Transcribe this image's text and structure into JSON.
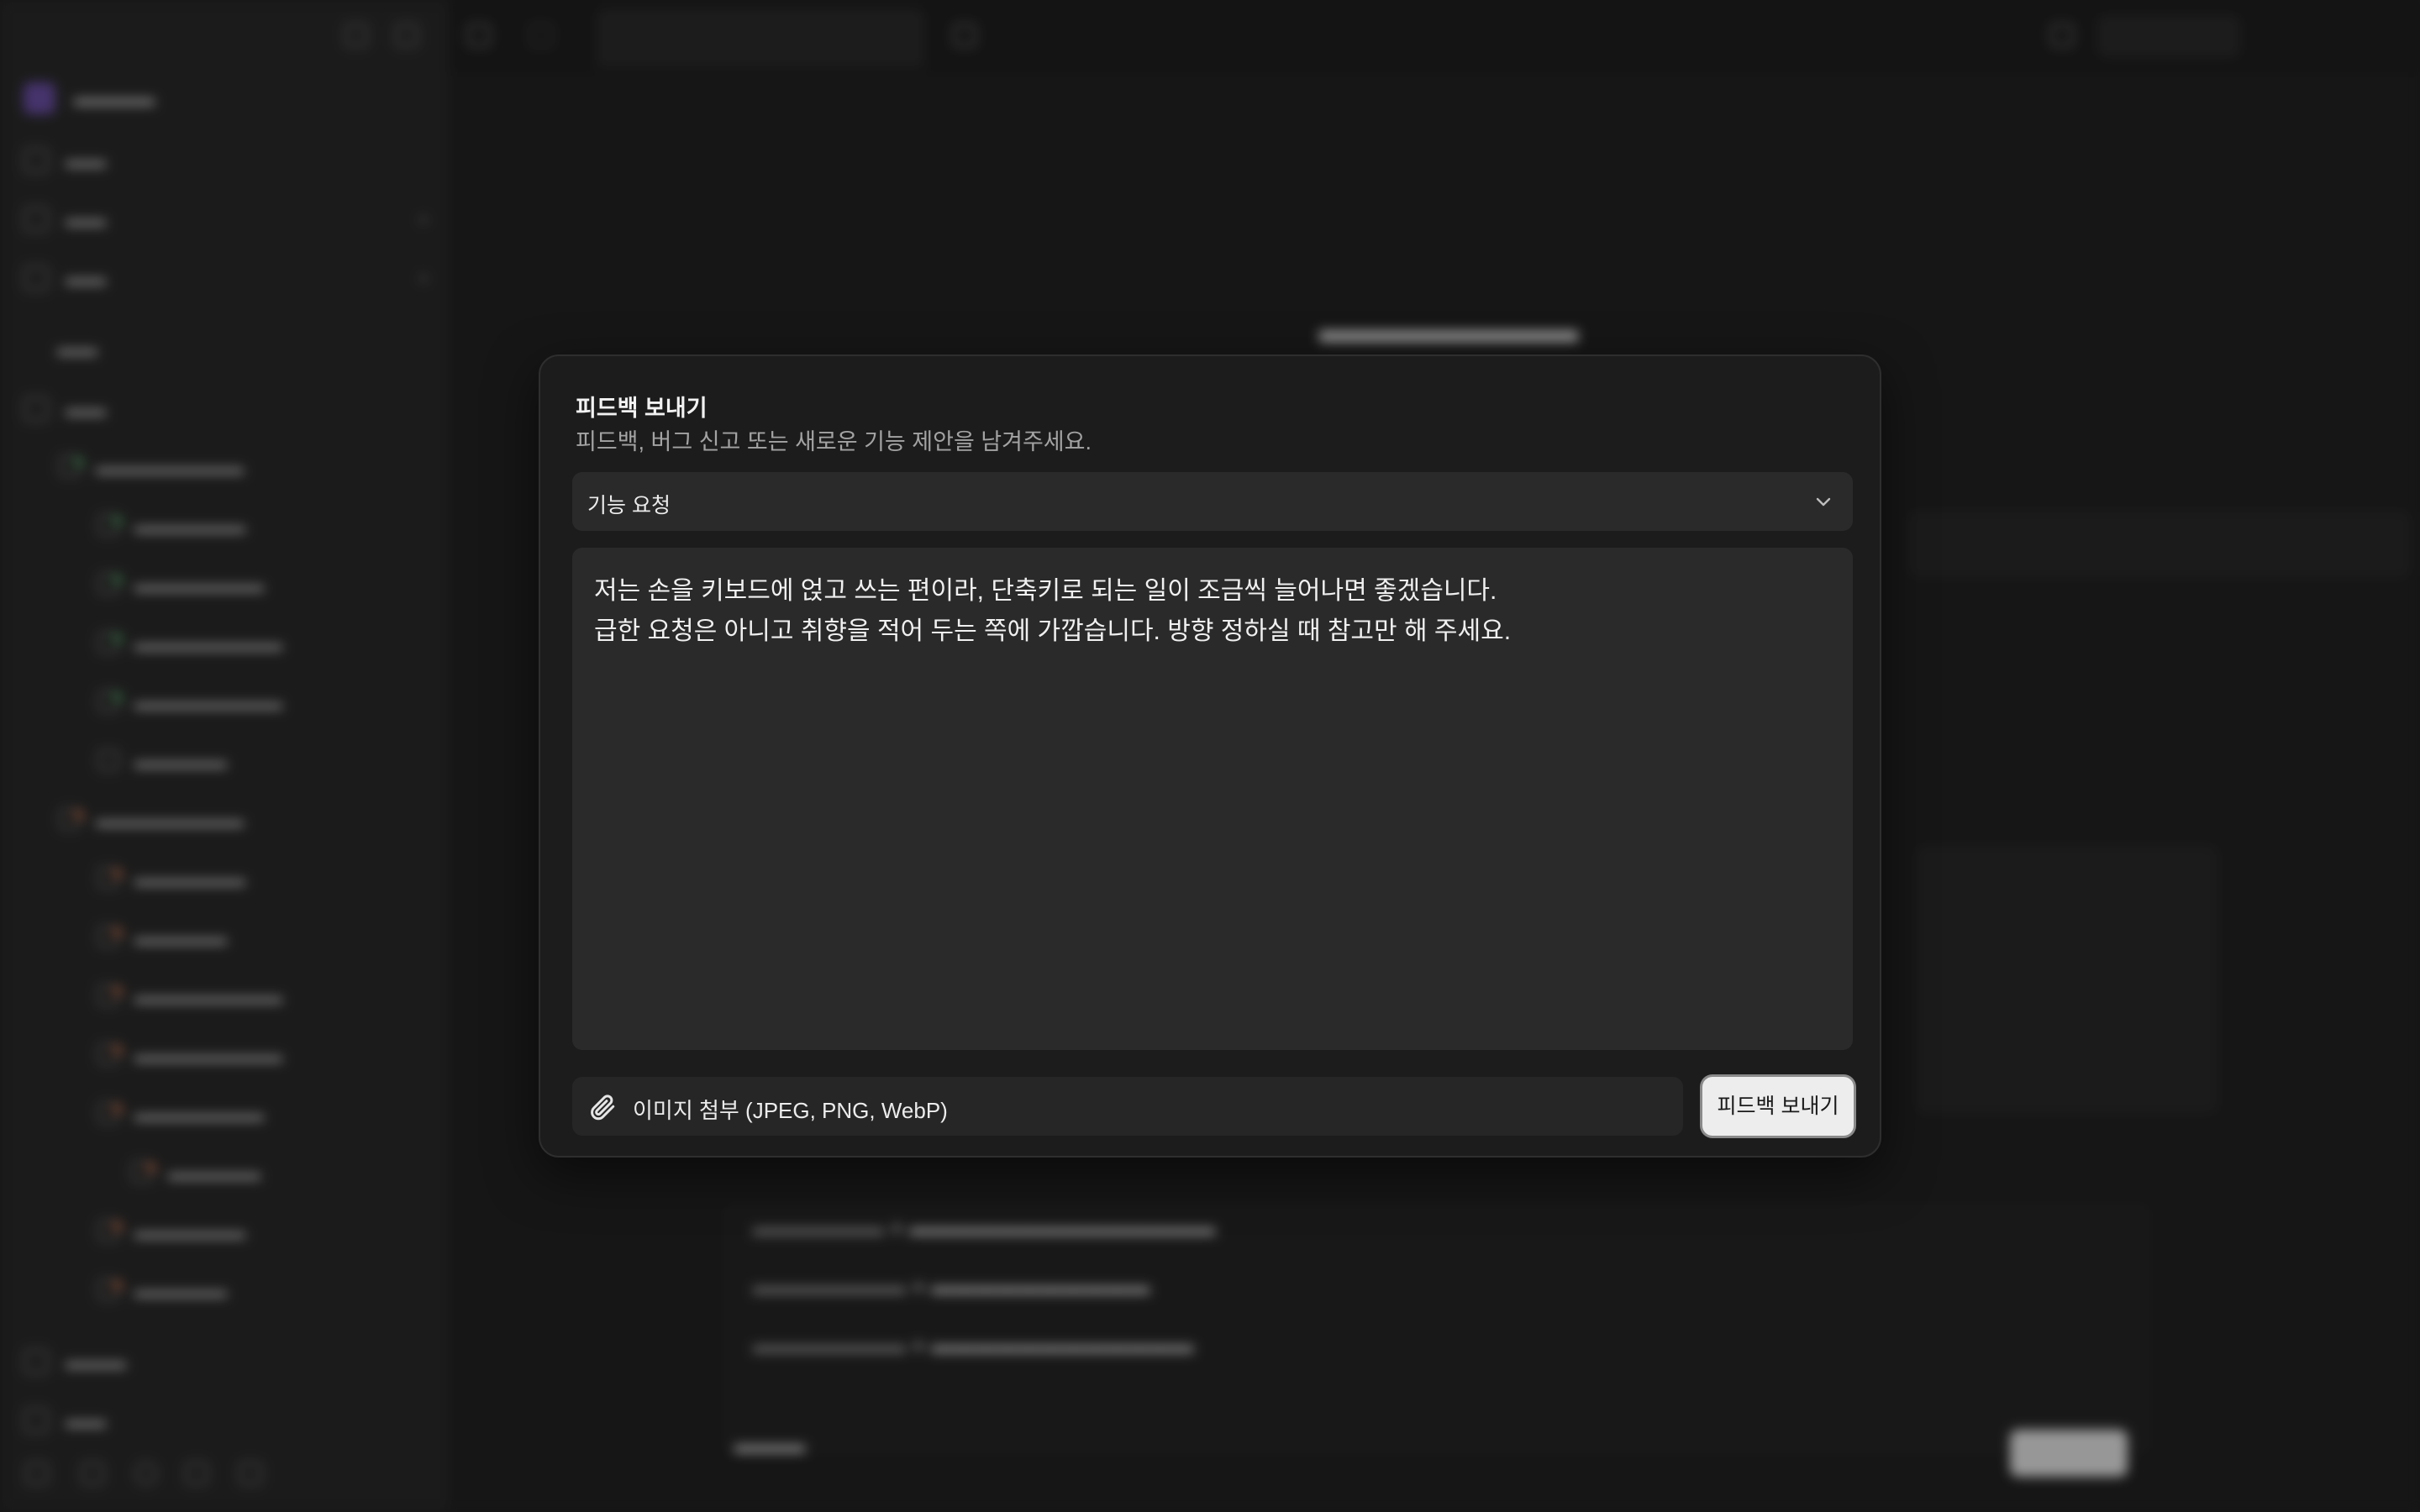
{
  "dialog": {
    "title": "피드백 보내기",
    "subtitle": "피드백, 버그 신고 또는 새로운 기능 제안을 남겨주세요.",
    "category": {
      "selected": "기능 요청",
      "icon": "chevron-down-icon"
    },
    "message": "저는 손을 키보드에 얹고 쓰는 편이라, 단축키로 되는 일이 조금씩 늘어나면 좋겠습니다.\n급한 요청은 아니고 취향을 적어 두는 쪽에 가깝습니다. 방향 정하실 때 참고만 해 주세요.",
    "attach_label": "이미지 첨부 (JPEG, PNG, WebP)",
    "attach_icon": "paperclip-icon",
    "submit_label": "피드백 보내기"
  },
  "colors": {
    "dialog_bg": "#1c1c1c",
    "field_bg": "#2a2a2a",
    "submit_bg": "#ededed",
    "status_green": "#3fae5b",
    "status_orange": "#e0673a"
  }
}
